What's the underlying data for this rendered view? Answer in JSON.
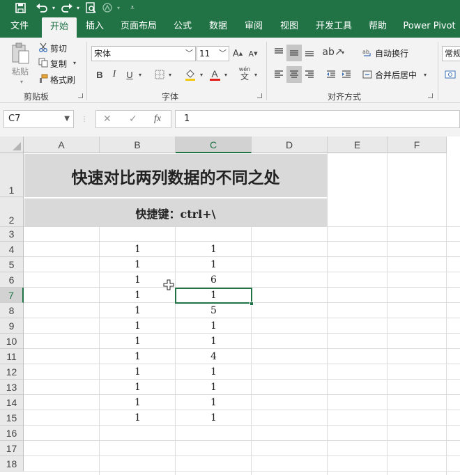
{
  "accent_color": "#217346",
  "quick_access": {
    "icons": [
      "save-icon",
      "undo-icon",
      "redo-icon",
      "print-preview-icon",
      "touch-mode-icon",
      "customize-qat-icon"
    ]
  },
  "tabs": [
    {
      "label": "文件"
    },
    {
      "label": "开始"
    },
    {
      "label": "插入"
    },
    {
      "label": "页面布局"
    },
    {
      "label": "公式"
    },
    {
      "label": "数据"
    },
    {
      "label": "审阅"
    },
    {
      "label": "视图"
    },
    {
      "label": "开发工具"
    },
    {
      "label": "帮助"
    },
    {
      "label": "Power Pivot"
    }
  ],
  "active_tab": "开始",
  "ribbon": {
    "clipboard": {
      "label": "剪贴板",
      "paste": "粘贴",
      "cut": "剪切",
      "copy": "复制",
      "format_painter": "格式刷"
    },
    "font": {
      "label": "字体",
      "font_name": "宋体",
      "font_size": "11",
      "grow": "A",
      "shrink": "A",
      "bold": "B",
      "italic": "I",
      "underline": "U",
      "font_color_letter": "A",
      "phonetic": "wén"
    },
    "alignment": {
      "label": "对齐方式",
      "wrap_text": "自动换行",
      "merge_center": "合并后居中"
    },
    "number": {
      "format": "常规"
    }
  },
  "formula_bar": {
    "name_box": "C7",
    "cancel": "✕",
    "enter": "✓",
    "function": "fx",
    "value": "1"
  },
  "sheet": {
    "columns": [
      "A",
      "B",
      "C",
      "D",
      "E",
      "F"
    ],
    "selected_column": "C",
    "rows": [
      "1",
      "2",
      "3",
      "4",
      "5",
      "6",
      "7",
      "8",
      "9",
      "10",
      "11",
      "12",
      "13",
      "14",
      "15",
      "16",
      "17",
      "18"
    ],
    "selected_row": "7",
    "active_cell": "C7",
    "title": "快速对比两列数据的不同之处",
    "subtitle": "快捷键：ctrl+\\",
    "col_b": [
      "1",
      "1",
      "1",
      "1",
      "1",
      "1",
      "1",
      "1",
      "1",
      "1",
      "1",
      "1"
    ],
    "col_c": [
      "1",
      "1",
      "6",
      "1",
      "5",
      "1",
      "1",
      "4",
      "1",
      "1",
      "1",
      "1"
    ]
  }
}
